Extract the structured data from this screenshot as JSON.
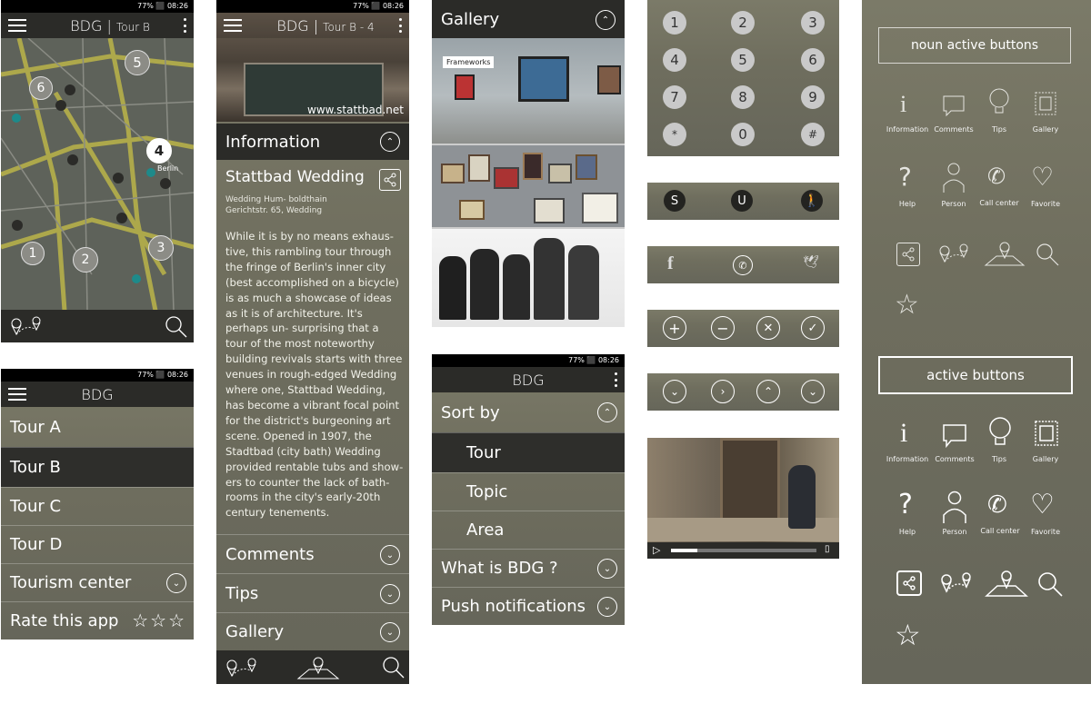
{
  "status": {
    "text": "77% ⬛ 08:26"
  },
  "map_screen": {
    "app_title": "BDG",
    "subtitle": "Tour B",
    "markers": [
      "5",
      "6",
      "4",
      "1",
      "2",
      "3"
    ],
    "map_labels": [
      "Berlin"
    ],
    "bottom_icons": [
      "map-pins-icon",
      "search-icon"
    ]
  },
  "menu_screen": {
    "app_title": "BDG",
    "items": [
      {
        "label": "Tour A"
      },
      {
        "label": "Tour B"
      },
      {
        "label": "Tour C"
      },
      {
        "label": "Tour D"
      },
      {
        "label": "Tourism center"
      },
      {
        "label": "Rate this app"
      }
    ]
  },
  "detail_screen": {
    "app_title": "BDG",
    "subtitle": "Tour B - 4",
    "image_caption": "www.stattbad.net",
    "section_title": "Information",
    "place_name": "Stattbad Wedding",
    "address_line1": "Wedding Hum- boldthain",
    "address_line2": "Gerichtstr. 65, Wedding",
    "body": "While it is by no means exhaus- tive, this rambling tour through the fringe of Berlin's inner city (best accomplished on a bicycle) is as much a showcase of ideas as it is of architecture. It's perhaps un- surprising that a tour of the most noteworthy building revivals starts with three venues in rough-edged Wedding where one, Stattbad Wedding, has become a vibrant focal point for the district's burgeoning art scene. Opened in 1907, the Stadtbad (city bath) Wedding provided rentable tubs and show- ers to counter the lack of bath- rooms in the city's early-20th century tenements.",
    "accordions": [
      {
        "label": "Comments"
      },
      {
        "label": "Tips"
      },
      {
        "label": "Gallery"
      }
    ]
  },
  "gallery_screen": {
    "title": "Gallery",
    "image_tag": "Frameworks"
  },
  "sort_screen": {
    "app_title": "BDG",
    "sort_title": "Sort by",
    "options": [
      {
        "label": "Tour"
      },
      {
        "label": "Topic"
      },
      {
        "label": "Area"
      }
    ],
    "rows": [
      {
        "label": "What is BDG ?"
      },
      {
        "label": "Push notifications"
      }
    ]
  },
  "keypad": {
    "keys": [
      "1",
      "2",
      "3",
      "4",
      "5",
      "6",
      "7",
      "8",
      "9",
      "*",
      "0",
      "#"
    ]
  },
  "transit_bar": {
    "items": [
      "S",
      "U"
    ]
  },
  "icon_sheet": {
    "inactive_title": "noun active buttons",
    "active_title": "active buttons",
    "labels": [
      "Information",
      "Comments",
      "Tips",
      "Gallery",
      "Help",
      "Person",
      "Call center",
      "Favorite"
    ]
  },
  "colors": {
    "olive": "#6f6e5e",
    "dark": "#2b2b28",
    "selected": "#3a3a36"
  }
}
